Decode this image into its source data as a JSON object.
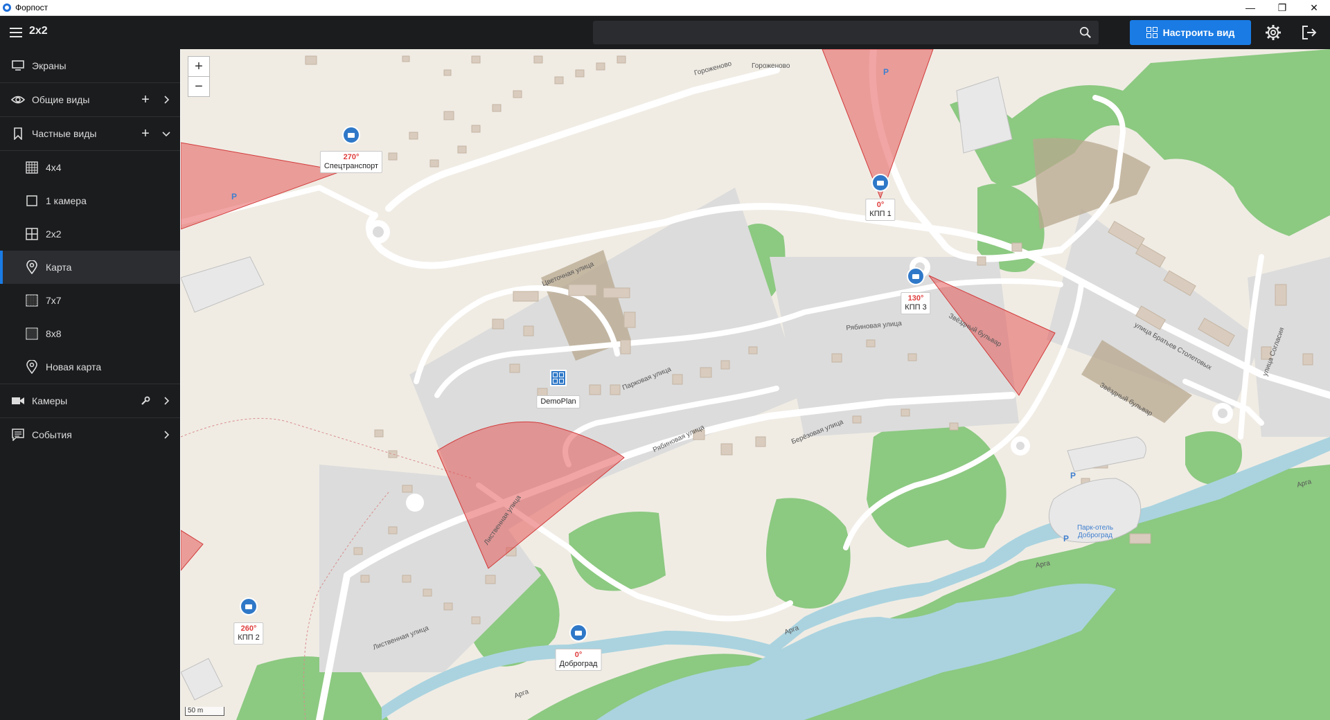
{
  "window": {
    "title": "Форпост",
    "controls": [
      "—",
      "❐",
      "✕"
    ]
  },
  "header": {
    "view_title": "2x2",
    "search_placeholder": "",
    "customize_label": "Настроить вид",
    "accent": "#1a7be4"
  },
  "sidebar": {
    "items": [
      {
        "label": "Экраны",
        "icon": "monitor-icon"
      },
      {
        "label": "Общие виды",
        "icon": "eye-icon",
        "action": "+"
      },
      {
        "label": "Частные виды",
        "icon": "bookmark-icon",
        "action": "+"
      },
      {
        "label": "4x4",
        "icon": "grid-4x4-icon"
      },
      {
        "label": "1 камера",
        "icon": "square-icon"
      },
      {
        "label": "2x2",
        "icon": "grid-2x2-icon"
      },
      {
        "label": "Карта",
        "icon": "map-pin-icon",
        "active": true
      },
      {
        "label": "7x7",
        "icon": "grid-7x7-icon"
      },
      {
        "label": "8x8",
        "icon": "grid-8x8-icon"
      },
      {
        "label": "Новая карта",
        "icon": "map-pin-icon"
      },
      {
        "label": "Камеры",
        "icon": "video-camera-icon"
      },
      {
        "label": "События",
        "icon": "events-icon"
      }
    ]
  },
  "map": {
    "zoom_in": "+",
    "zoom_out": "−",
    "scale": "50 m",
    "cameras": [
      {
        "name": "Спецтранспорт",
        "angle": "270°"
      },
      {
        "name": "КПП 1",
        "angle": "0°"
      },
      {
        "name": "КПП 3",
        "angle": "130°"
      },
      {
        "name": "КПП 2",
        "angle": "260°"
      },
      {
        "name": "Доброград",
        "angle": "0°"
      }
    ],
    "plan_marker": "DemoPlan",
    "streets": [
      "Гороженово",
      "Гороженово",
      "Цветочная улица",
      "Парковая улица",
      "Рябиновая улица",
      "Рябиновая улица",
      "Берёзовая улица",
      "Лиственная улица",
      "Лиственная улица",
      "Звёздный бульвар",
      "Звёздный бульвар",
      "улица Братьев Столетовых",
      "улица Согласия",
      "Арга",
      "Арга",
      "Арга",
      "Арга"
    ],
    "poi": "Парк-отель Доброград",
    "parking": "P"
  }
}
